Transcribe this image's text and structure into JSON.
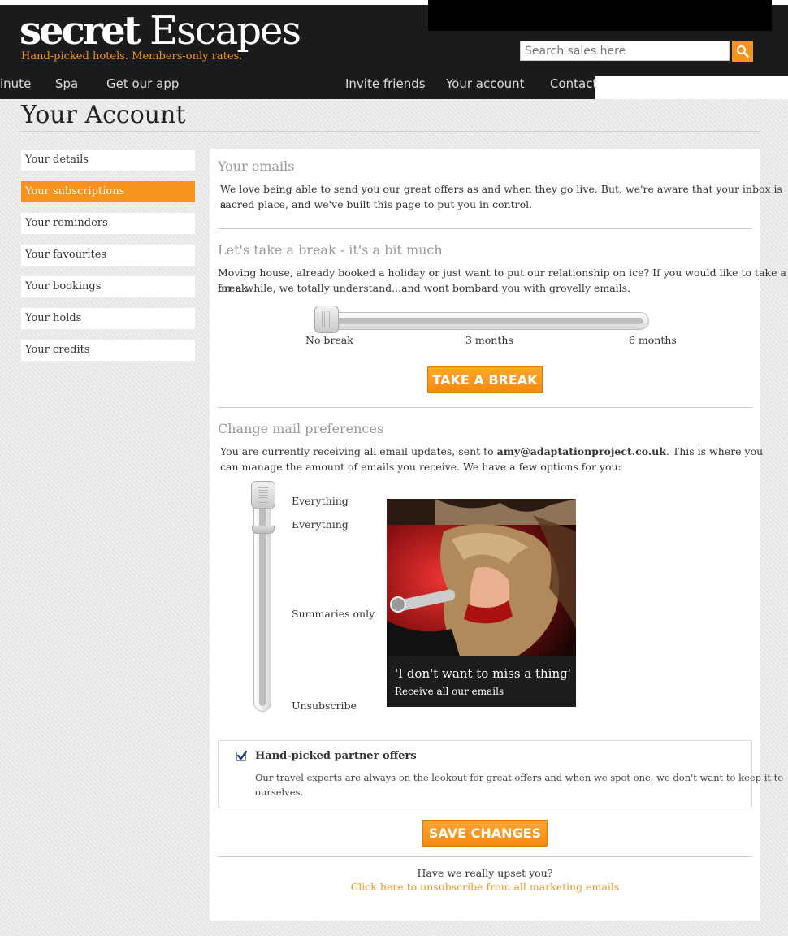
{
  "header": {
    "logo_secret": "secret",
    "logo_escapes": "Escapes",
    "tagline": "Hand-picked hotels. Members-only rates.",
    "search_placeholder": "Search sales here",
    "nav_left": [
      "inute",
      "Spa",
      "Get our app"
    ],
    "nav_right": [
      "Invite friends",
      "Your account",
      "Contact"
    ]
  },
  "page_title": "Your Account",
  "sidebar": {
    "items": [
      {
        "label": "Your details",
        "active": false
      },
      {
        "label": "Your subscriptions",
        "active": true
      },
      {
        "label": "Your reminders",
        "active": false
      },
      {
        "label": "Your favourites",
        "active": false
      },
      {
        "label": "Your bookings",
        "active": false
      },
      {
        "label": "Your holds",
        "active": false
      },
      {
        "label": "Your credits",
        "active": false
      }
    ]
  },
  "emails": {
    "title": "Your emails",
    "text_line1": "We love being able to send you our great offers as and when they go live. But, we're aware that your inbox is a",
    "text_line2": "sacred place, and we've built this page to put you in control."
  },
  "break_section": {
    "title": "Let's take a break - it's a bit much",
    "text_line1": "Moving house, already booked a holiday or just want to put our relationship on ice? If you would like to take a break",
    "text_line2": "for a while, we totally understand...and wont bombard you with grovelly emails.",
    "slider_labels": [
      "No break",
      "3 months",
      "6 months"
    ],
    "slider_value": "No break",
    "button_label": "TAKE A BREAK"
  },
  "mail_prefs": {
    "title": "Change mail preferences",
    "text_prefix": "You are currently receiving all email updates, sent to ",
    "email": "amy@adaptationproject.co.uk",
    "text_suffix": ". This is where you",
    "text_line2": "can manage the amount of emails you receive. We have a few options for you:",
    "options": [
      "Everything",
      "Everything",
      "Summaries only",
      "Unsubscribe"
    ],
    "selected": "Everything",
    "card_title": "'I don't want to miss a thing'",
    "card_subtitle": "Receive all our emails"
  },
  "partner": {
    "checked": true,
    "title": "Hand-picked partner offers",
    "text_line1": "Our travel experts are always on the lookout for great offers and when we spot one, we don't want to keep it to",
    "text_line2": "ourselves."
  },
  "save_button": "SAVE CHANGES",
  "upset": {
    "question": "Have we really upset you?",
    "link": "Click here to unsubscribe from all marketing emails"
  },
  "colors": {
    "accent": "#f7941d",
    "header_bg": "#1b1b1b"
  },
  "icons": {
    "search": "magnifier-icon",
    "check": "checkmark-icon"
  }
}
